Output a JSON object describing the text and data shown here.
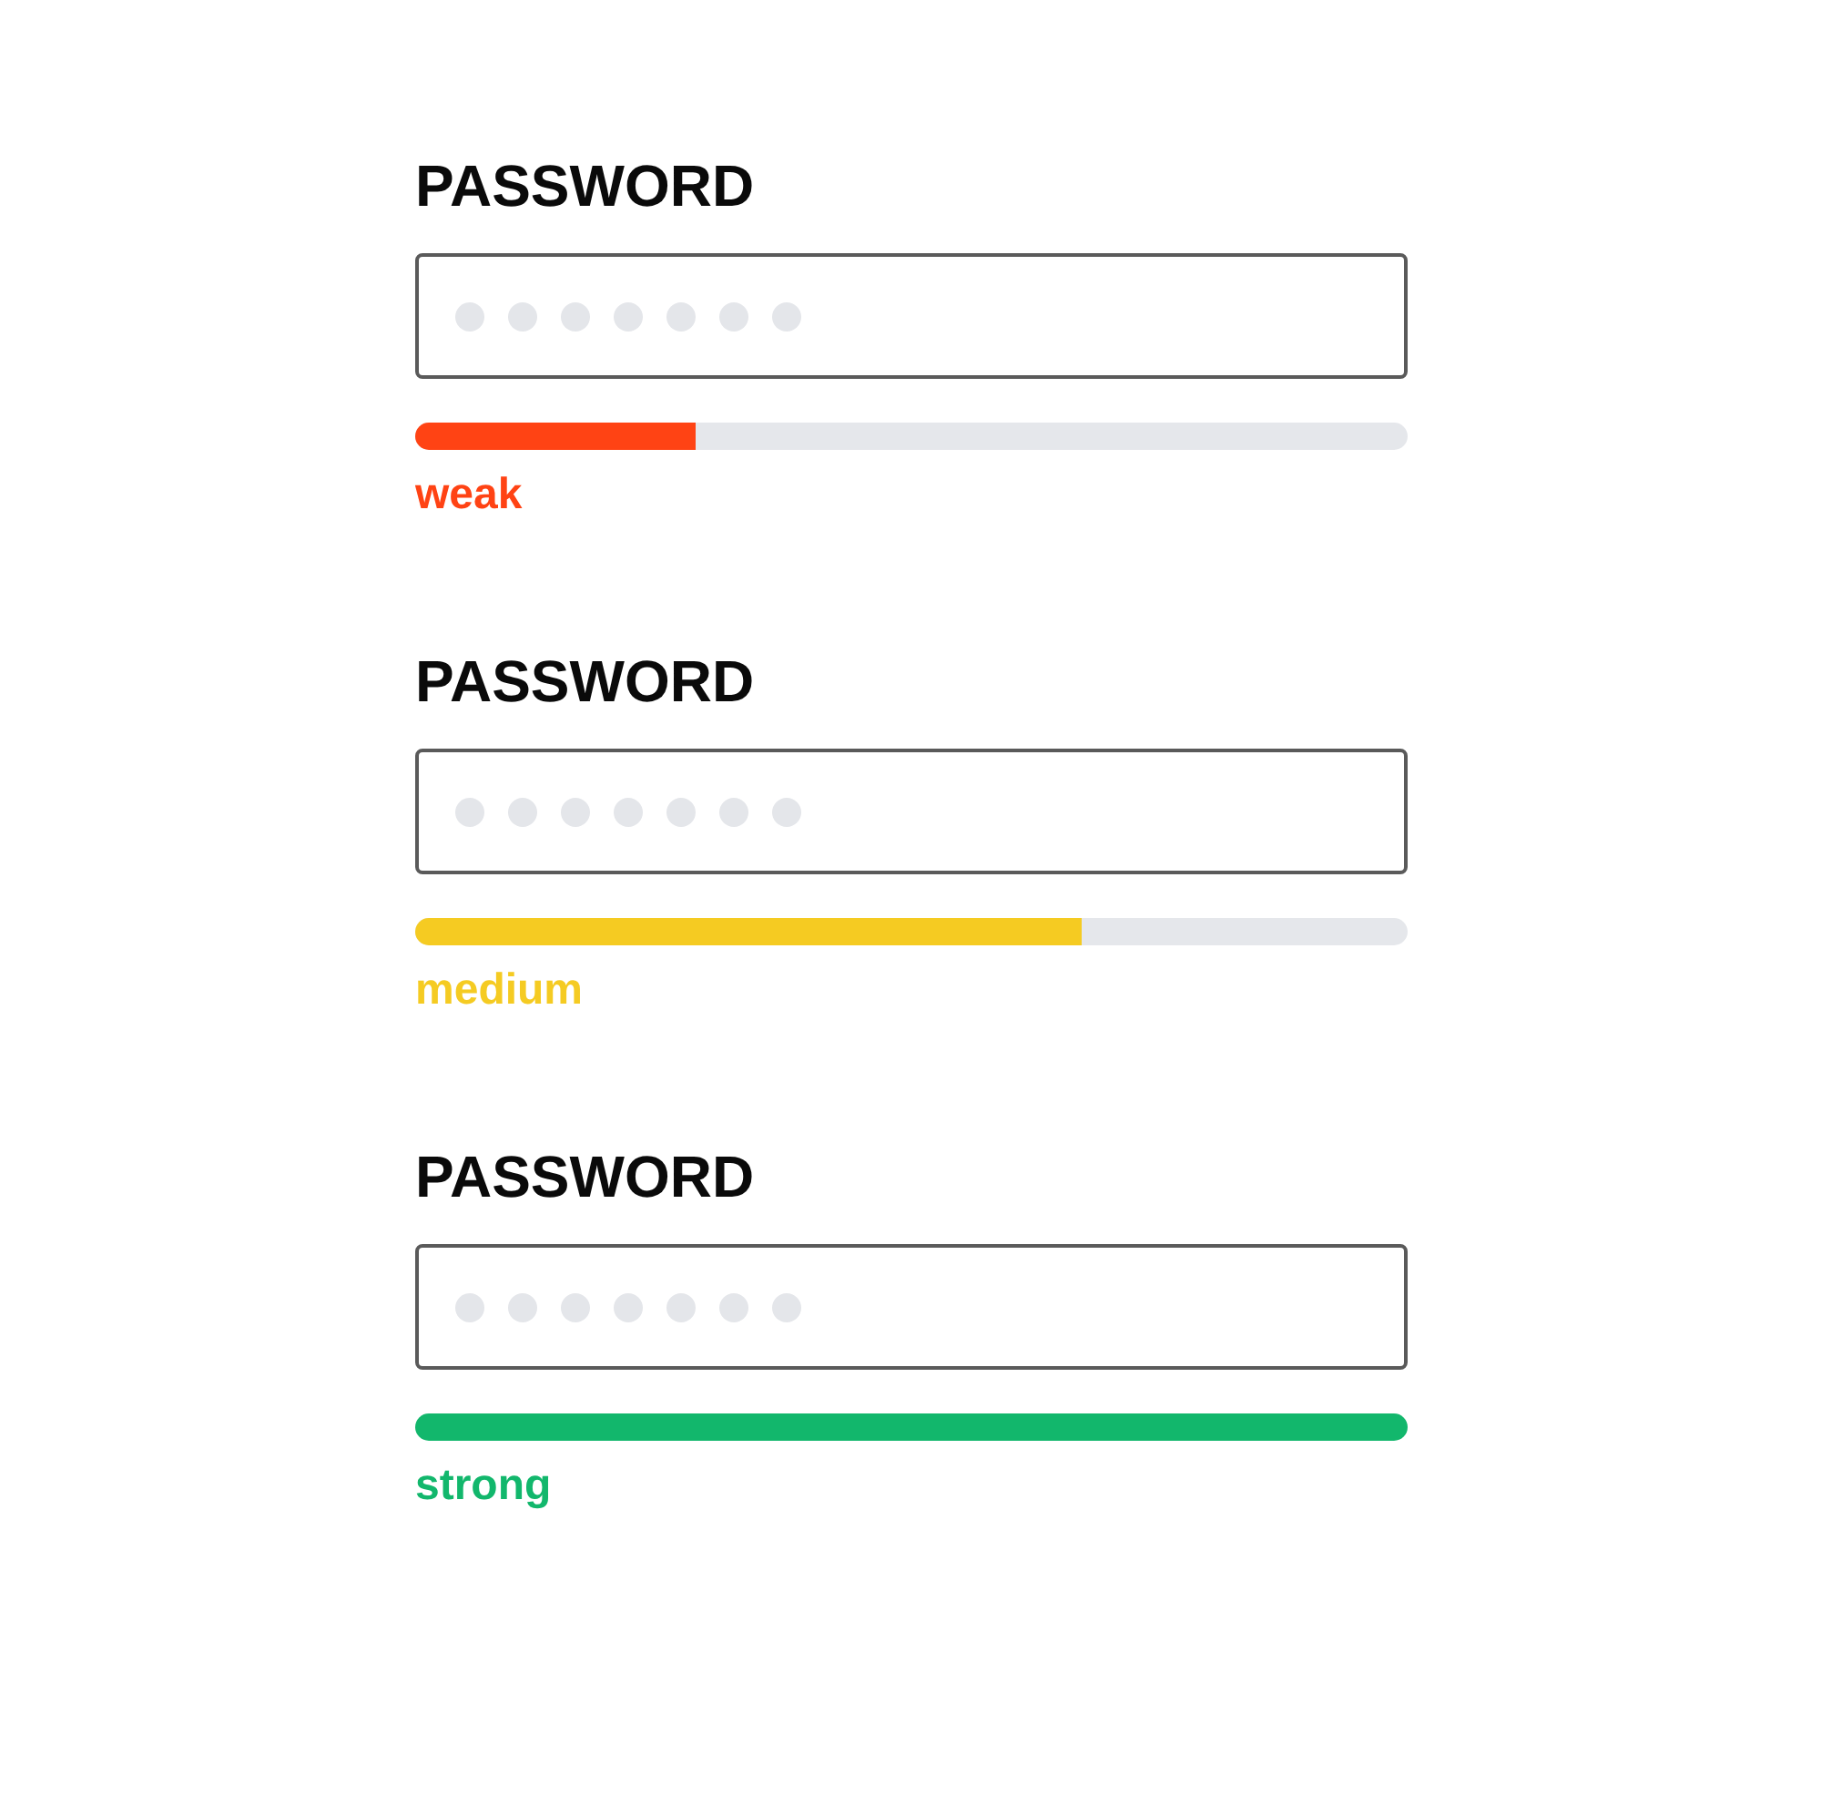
{
  "fields": [
    {
      "label": "PASSWORD",
      "level": 0.283,
      "color": "#ff4314",
      "strength": "weak"
    },
    {
      "label": "PASSWORD",
      "level": 0.672,
      "color": "#f5cb22",
      "strength": "medium"
    },
    {
      "label": "PASSWORD",
      "level": 1,
      "color": "#12b76c",
      "strength": "strong"
    }
  ]
}
